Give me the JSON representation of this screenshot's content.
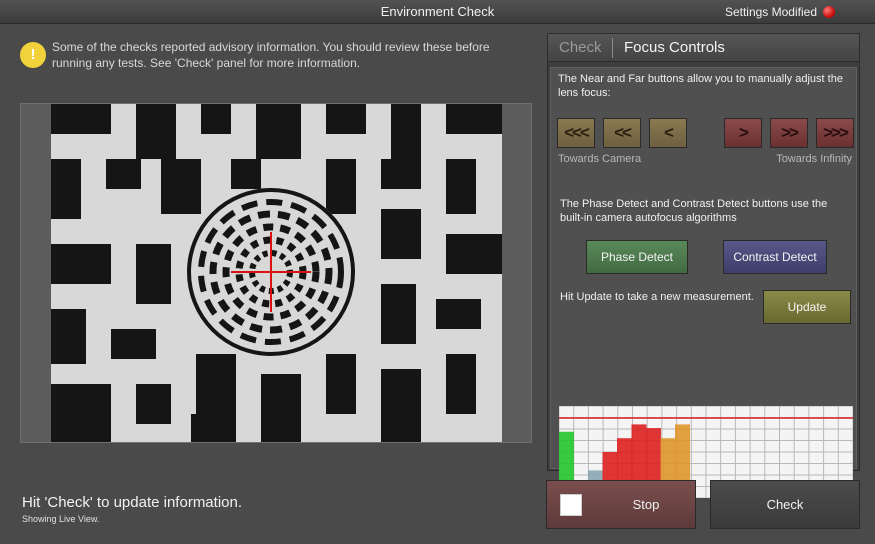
{
  "window": {
    "title": "Environment Check",
    "settings_status": "Settings Modified"
  },
  "advisory": {
    "icon": "warning-icon",
    "text": "Some of the checks reported advisory information.  You should review these before running any tests.  See 'Check' panel for more information."
  },
  "status": {
    "main": "Hit 'Check' to update information.",
    "sub": "Showing Live View."
  },
  "panel": {
    "tabs": {
      "check": "Check",
      "focus": "Focus Controls"
    },
    "manual_text": "The Near and Far buttons allow you to manually adjust the lens focus:",
    "near_buttons": [
      "<<<",
      "<<",
      "<"
    ],
    "far_buttons": [
      ">",
      ">>",
      ">>>"
    ],
    "towards_camera": "Towards Camera",
    "towards_infinity": "Towards Infinity",
    "autofocus_text": "The Phase Detect and Contrast Detect buttons use the built-in camera autofocus algorithms",
    "phase_detect": "Phase Detect",
    "contrast_detect": "Contrast Detect",
    "update_text": "Hit Update to take a new measurement.",
    "update": "Update"
  },
  "focus_graph": {
    "bars": [
      {
        "value": 0.72,
        "color": "#22c52e"
      },
      {
        "value": 0.1,
        "color": "#8aa7b4"
      },
      {
        "value": 0.3,
        "color": "#8aa7b4"
      },
      {
        "value": 0.5,
        "color": "#dd2020"
      },
      {
        "value": 0.65,
        "color": "#dd2020"
      },
      {
        "value": 0.8,
        "color": "#dd2020"
      },
      {
        "value": 0.76,
        "color": "#dd2020"
      },
      {
        "value": 0.65,
        "color": "#e0962a"
      },
      {
        "value": 0.8,
        "color": "#e0962a"
      }
    ],
    "threshold": 0.87,
    "threshold_color": "#dd2020"
  },
  "actions": {
    "stop": "Stop",
    "check": "Check"
  },
  "colors": {
    "phase": "#4d7a4d",
    "contrast": "#4a4a78",
    "update": "#7a7a3a"
  }
}
